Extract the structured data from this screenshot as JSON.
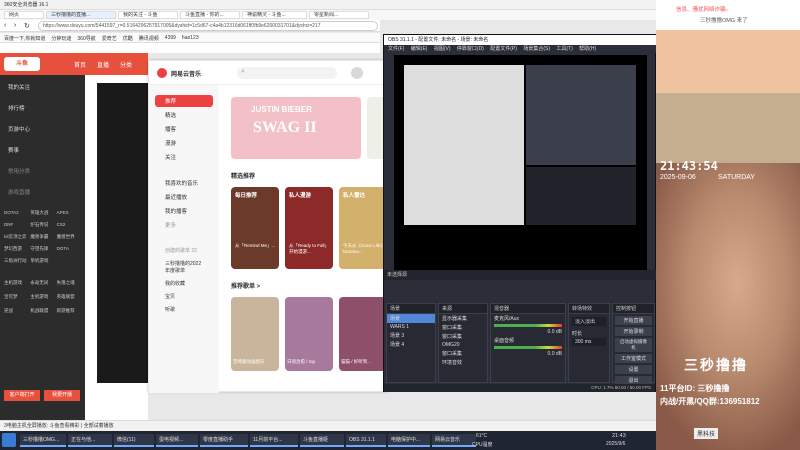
{
  "browser": {
    "title": "360安全浏览器 16.1",
    "url": "https://www.douyu.com/5441597_r=0.5164296257917005&dyshid=1c5d67-c4a4b12316d061ff0fb9e6200031701&dyshci=217",
    "tabs": [
      "网页",
      "三秒撸撸的直播...",
      "我的关注 - 斗鱼",
      "斗鱼直播 - 你的...",
      "神谕精灵 - 斗鱼...",
      "零星新闻..."
    ],
    "bookmarks": [
      "百度一下,你就知道",
      "分钟玩谜",
      "360导航",
      "爱奇艺",
      "优酷",
      "腾讯视频",
      "4399",
      "hao123"
    ]
  },
  "douyu": {
    "nav": [
      "首页",
      "直播",
      "分类"
    ],
    "side_items": [
      "我的关注",
      "排行榜",
      "页游中心",
      "赛事",
      "常用分类",
      "游戏直播"
    ],
    "games": [
      "DOTA2",
      "英雄大战",
      "APEX",
      "DNF",
      "炉石传说",
      "CS2",
      "lol云顶之弈",
      "魔兽争霸",
      "魔兽世界",
      "梦幻西游",
      "守望先锋",
      "DOTA",
      "三角洲行动",
      "单机游戏"
    ],
    "more_items": [
      "主机游戏",
      "永劫无间",
      "失落之魂",
      "宝可梦",
      "主机游戏",
      "英雄联盟",
      "逆战",
      "机战联盟",
      "新游推荐"
    ],
    "bottom_buttons": [
      "客户端打开",
      "我要开播"
    ],
    "status_text": "3电脑主机全屏播放: 斗鱼查看精彩 | 全部试着播放"
  },
  "music": {
    "app_name": "网易云音乐",
    "nav": [
      "推荐",
      "精选",
      "播客",
      "漫游",
      "关注",
      "我喜欢的音乐",
      "最近播放",
      "我的播客"
    ],
    "collection_header": "创建的歌单 22",
    "playlists": [
      "三秒撸撸的2022年度歌单",
      "我的收藏",
      "宝贝",
      "听歌"
    ],
    "banner_title": "JUSTIN BIEBER",
    "banner_sub": "SWAG II",
    "section_recommended": "精选推荐",
    "cards": [
      {
        "title": "每日推荐",
        "caption": "从「Remind Me」..."
      },
      {
        "title": "私人漫游",
        "caption": "从「Ready to Fall」开始漫游..."
      },
      {
        "title": "私人雷达",
        "caption": "今天从《Gone Life》Nanana..."
      }
    ],
    "section_playlists": "推荐歌单 >",
    "playlist_captions": [
      "宫崎骏动画配乐",
      "日语治愈 / top",
      "猫猫 / 好听到..."
    ],
    "side_label_more": "更多"
  },
  "obs": {
    "title": "OBS 31.1.1 - 配置文件: 未命名 - 场景: 未命名",
    "menu": [
      "文件(F)",
      "编辑(E)",
      "视图(V)",
      "停靠窗口(D)",
      "配置文件(P)",
      "场景集合(S)",
      "工具(T)",
      "帮助(H)"
    ],
    "source_label": "未选择源",
    "docks": [
      "场景",
      "来源",
      "混音器",
      "转场特效",
      "控制按钮"
    ],
    "scenes": [
      "场景",
      "WARS 1",
      "场景 3",
      "场景 4"
    ],
    "sources": [
      "显示器采集",
      "窗口采集",
      "窗口采集",
      "OMG20",
      "窗口采集",
      "环境音效"
    ],
    "mixer": [
      {
        "name": "麦克风/Aux",
        "db": "0.0 dB"
      },
      {
        "name": "桌面音频",
        "db": "0.0 dB"
      }
    ],
    "transition": {
      "type": "淡入淡出",
      "duration_label": "时长",
      "duration": "300 ms"
    },
    "controls": [
      "开始直播",
      "开始录制",
      "启动虚拟摄像机",
      "工作室模式",
      "设置",
      "退出"
    ],
    "footer": "CPU: 1.7%  60.00 / 60.00 FPS"
  },
  "overlay": {
    "time": "21:43:54",
    "date": "2025-09-06",
    "weekday": "SATURDAY",
    "name": "三秒撸撸",
    "line1": "11平台ID: 三秒撸撸",
    "line2": "内战/开黑/QQ群:136951812",
    "chat_top": "信息、骚扰网络诈骗。",
    "chat_top2": "三秒撸撸OMG 来了",
    "chat_bottom": "黑科技"
  },
  "taskbar": {
    "items": [
      "三秒撸撸OMG...",
      "正在与他...",
      "微信(11)",
      "蛋电视频...",
      "零度直播助手",
      "11月前平台...",
      "斗鱼直播姬",
      "OBS 31.1.1",
      "电脑保护中...",
      "网易云音乐"
    ],
    "temp": "61°C",
    "cpu_label": "CPU温度",
    "clock": "21:43",
    "date": "2025/9/6"
  },
  "colors": {
    "douyu_red": "#e7503c",
    "netease_red": "#ec4141",
    "obs_bg": "#2b2e38",
    "accent_blue": "#5186d8"
  }
}
